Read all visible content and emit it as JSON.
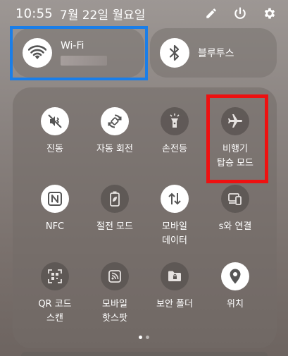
{
  "status": {
    "time": "10:55",
    "date": "7월 22일 월요일"
  },
  "wifi": {
    "label": "Wi-Fi"
  },
  "bluetooth": {
    "label": "블루투스"
  },
  "tiles": [
    {
      "label": "진동",
      "icon": "vibrate-icon",
      "state": "on"
    },
    {
      "label": "자동 회전",
      "icon": "auto-rotate-icon",
      "state": "on"
    },
    {
      "label": "손전등",
      "icon": "flashlight-icon",
      "state": "off"
    },
    {
      "label": "비행기\n탑승 모드",
      "icon": "airplane-icon",
      "state": "off"
    },
    {
      "label": "NFC",
      "icon": "nfc-icon",
      "state": "on"
    },
    {
      "label": "절전 모드",
      "icon": "battery-saver-icon",
      "state": "off"
    },
    {
      "label": "모바일\n데이터",
      "icon": "mobile-data-icon",
      "state": "on"
    },
    {
      "label": "s와 연결",
      "icon": "connect-devices-icon",
      "state": "off"
    },
    {
      "label": "QR 코드\n스캔",
      "icon": "qr-scan-icon",
      "state": "off"
    },
    {
      "label": "모바일\n핫스팟",
      "icon": "hotspot-icon",
      "state": "off"
    },
    {
      "label": "보안 폴더",
      "icon": "secure-folder-icon",
      "state": "off"
    },
    {
      "label": "위치",
      "icon": "location-icon",
      "state": "on"
    }
  ],
  "pager": {
    "pages": 2,
    "current": 1
  },
  "colors": {
    "highlight_blue": "#1a7ee8",
    "highlight_red": "#ee1111",
    "tile_on": "#ffffff"
  }
}
